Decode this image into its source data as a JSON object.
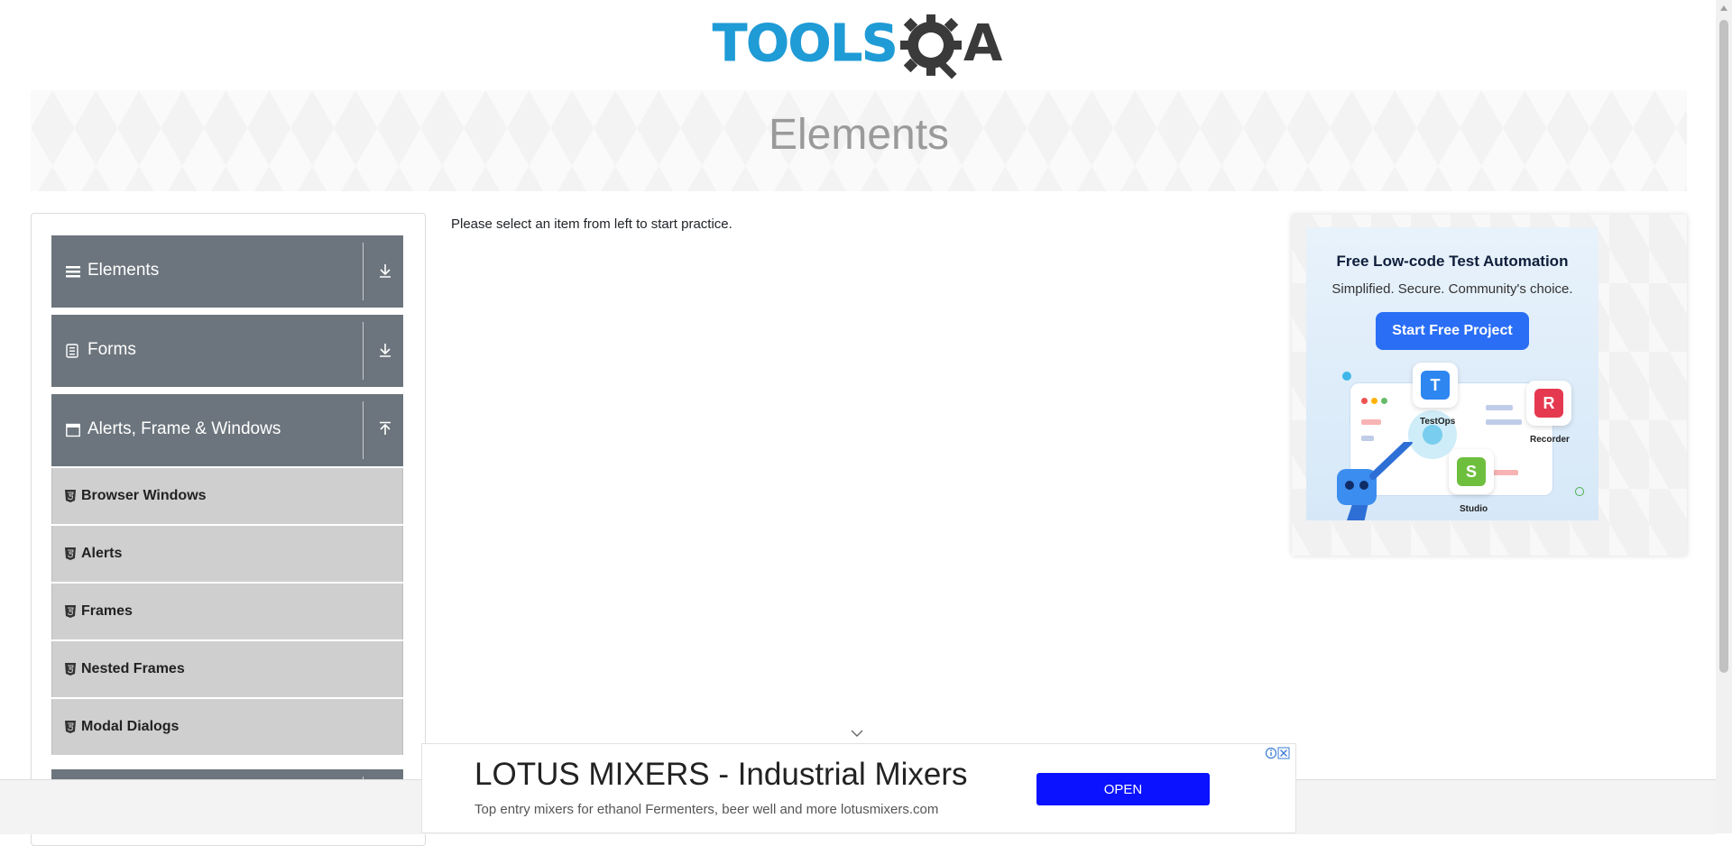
{
  "header": {
    "logo_text_blue": "TOOLS",
    "logo_text_dark": "A",
    "brand_color": "#1f9bd6"
  },
  "banner": {
    "title": "Elements"
  },
  "sidebar": {
    "groups": [
      {
        "label": "Elements",
        "icon": "hamburger-icon",
        "arrow": "download-icon",
        "expanded": false
      },
      {
        "label": "Forms",
        "icon": "form-icon",
        "arrow": "download-icon",
        "expanded": false
      },
      {
        "label": "Alerts, Frame & Windows",
        "icon": "window-icon",
        "arrow": "upload-icon",
        "expanded": true
      }
    ],
    "items": [
      {
        "label": "Browser Windows"
      },
      {
        "label": "Alerts"
      },
      {
        "label": "Frames"
      },
      {
        "label": "Nested Frames"
      },
      {
        "label": "Modal Dialogs"
      }
    ],
    "header_color": "#6c757d"
  },
  "main": {
    "prompt": "Please select an item from left to start practice."
  },
  "right_ad": {
    "title": "Free Low-code Test Automation",
    "subtitle": "Simplified. Secure. Community's choice.",
    "button": "Start Free Project",
    "apps": [
      "TestOps",
      "Recorder",
      "Studio"
    ],
    "app_letters": [
      "T",
      "R",
      "S"
    ]
  },
  "bottom_ad": {
    "headline": "LOTUS MIXERS - Industrial Mixers",
    "description": "Top entry mixers for ethanol Fermenters, beer well and more lotusmixers.com",
    "button": "OPEN",
    "button_color": "#0a12ff"
  }
}
